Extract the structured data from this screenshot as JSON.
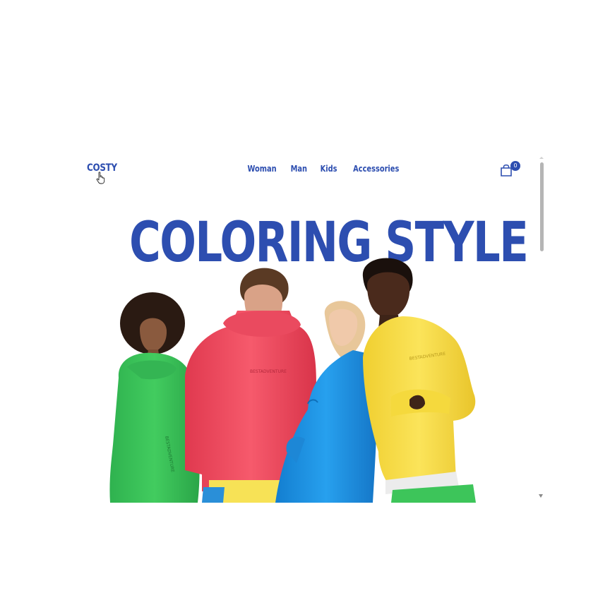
{
  "header": {
    "logo": "COSTY",
    "nav": [
      "Woman",
      "Man",
      "Kids",
      "Accessories"
    ],
    "cart_count": "0"
  },
  "hero": {
    "headline": "COLORING STYLE",
    "hoodie_print": "BESTADVENTURE"
  },
  "colors": {
    "brand": "#2d4eb0",
    "green": "#3dc55a",
    "red": "#f04f63",
    "blue": "#1e8fe0",
    "yellow": "#f8e04a"
  },
  "icons": [
    "pointer-hand-icon",
    "shopping-bag-icon"
  ]
}
